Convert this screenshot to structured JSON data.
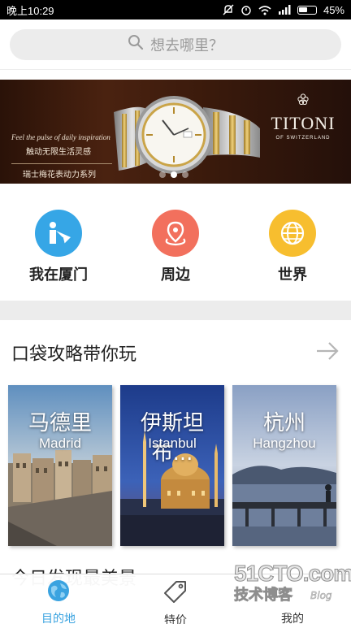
{
  "status_bar": {
    "time": "晚上10:29",
    "battery": "45%"
  },
  "search": {
    "placeholder": "想去哪里？"
  },
  "banner": {
    "slogan_en": "Feel the pulse of daily inspiration",
    "slogan_cn_1": "触动无限生活灵感",
    "slogan_cn_2": "瑞士梅花表动力系列",
    "brand_name": "TITONI",
    "brand_sub": "OF SWITZERLAND",
    "slide_count": 3,
    "active_slide": 1
  },
  "categories": [
    {
      "label": "我在厦门",
      "color": "#36a6e6",
      "icon": "location-person-icon"
    },
    {
      "label": "周边",
      "color": "#f2705d",
      "icon": "map-pin-icon"
    },
    {
      "label": "世界",
      "color": "#f7be2f",
      "icon": "globe-icon"
    }
  ],
  "guide": {
    "title": "口袋攻略带你玩",
    "cards": [
      {
        "cn": "马德里",
        "en": "Madrid"
      },
      {
        "cn": "伊斯坦布...",
        "en": "Istanbul"
      },
      {
        "cn": "杭州",
        "en": "Hangzhou"
      }
    ]
  },
  "next_section_title": "今日发现最美景",
  "tabbar": [
    {
      "label": "目的地",
      "icon": "destination-globe-icon",
      "active": true
    },
    {
      "label": "特价",
      "icon": "price-tag-icon",
      "active": false
    },
    {
      "label": "我的",
      "icon": "profile-icon",
      "active": false
    }
  ],
  "watermark": {
    "line1": "51CTO.com",
    "line2": "技术博客",
    "line3": "Blog"
  }
}
